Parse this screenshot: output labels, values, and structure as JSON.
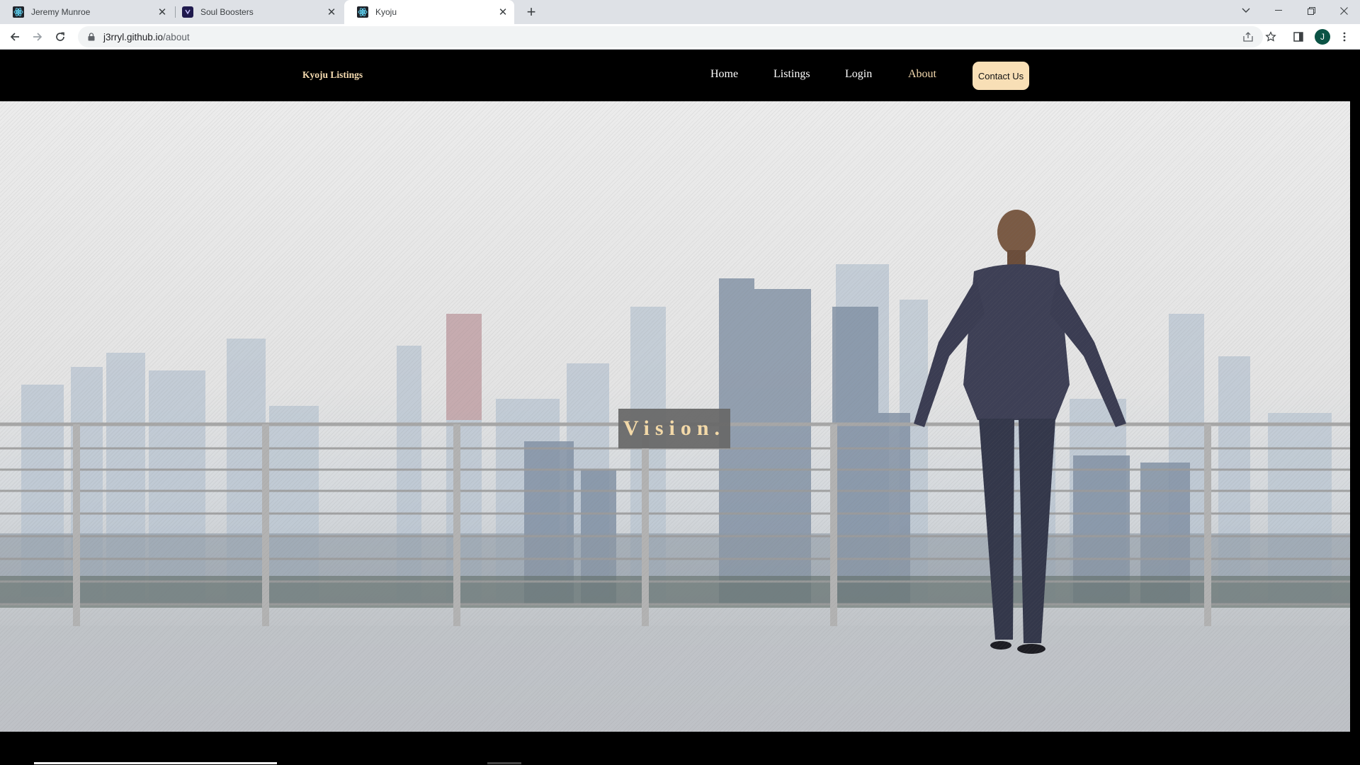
{
  "browser": {
    "tabs": [
      {
        "title": "Jeremy Munroe",
        "active": false,
        "icon": "react-icon"
      },
      {
        "title": "Soul Boosters",
        "active": false,
        "icon": "soul-boosters-icon"
      },
      {
        "title": "Kyoju",
        "active": true,
        "icon": "react-icon"
      }
    ],
    "url_host": "j3rryl.github.io",
    "url_path": "/about",
    "profile_initial": "J"
  },
  "site": {
    "brand": "Kyoju Listings",
    "nav": [
      {
        "label": "Home",
        "active": false
      },
      {
        "label": "Listings",
        "active": false
      },
      {
        "label": "Login",
        "active": false
      },
      {
        "label": "About",
        "active": true
      }
    ],
    "contact_label": "Contact Us",
    "hero_text": "Vision.",
    "accent_color": "#f5dbb0"
  }
}
